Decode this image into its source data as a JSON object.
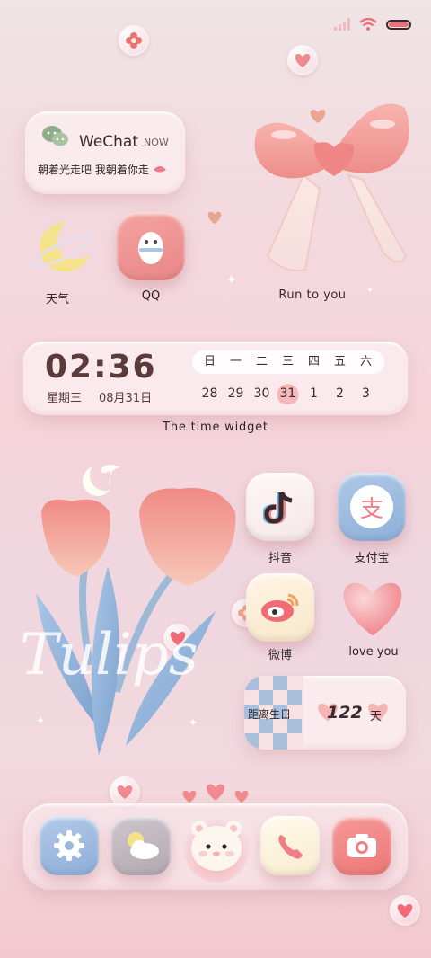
{
  "wechat": {
    "app": "WeChat",
    "time": "NOW",
    "message": "朝着光走吧 我朝着你走"
  },
  "apps": {
    "weather": "天气",
    "qq": "QQ",
    "douyin": "抖音",
    "alipay": "支付宝",
    "weibo": "微博",
    "love": "love you"
  },
  "bow_caption": "Run to you",
  "clock": {
    "time": "02:36",
    "weekday": "星期三",
    "date": "08月31日",
    "week_days": [
      "日",
      "一",
      "二",
      "三",
      "四",
      "五",
      "六"
    ],
    "days": [
      "28",
      "29",
      "30",
      "31",
      "1",
      "2",
      "3"
    ],
    "caption": "The time widget"
  },
  "tulips_text": "Tulips",
  "countdown": {
    "label": "距离生日",
    "number": "122",
    "unit": "天"
  },
  "alipay_glyph": "支",
  "colors": {
    "accent": "#e9807f",
    "text": "#5a3a3a"
  }
}
